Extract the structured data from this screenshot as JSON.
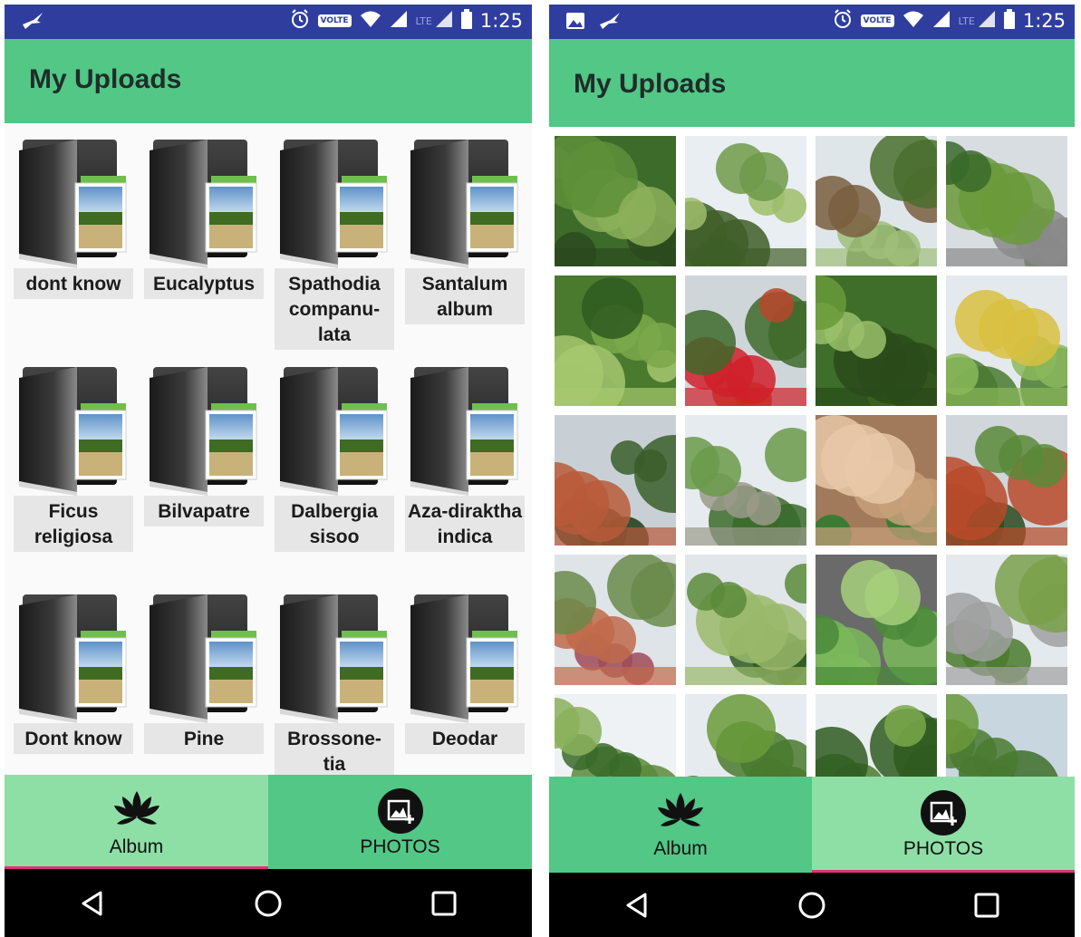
{
  "left": {
    "status_bar": {
      "time": "1:25",
      "volte": "VOLTE",
      "lte": "LTE"
    },
    "title": "My Uploads",
    "albums": [
      {
        "label": "dont know"
      },
      {
        "label": "Eucalyptus"
      },
      {
        "label": "Spathodia companu-lata"
      },
      {
        "label": "Santalum album"
      },
      {
        "label": "Ficus religiosa"
      },
      {
        "label": "Bilvapatre"
      },
      {
        "label": "Dalbergia sisoo"
      },
      {
        "label": "Aza-diraktha indica"
      },
      {
        "label": "Dont know"
      },
      {
        "label": "Pine"
      },
      {
        "label": "Brossone-tia"
      },
      {
        "label": "Deodar"
      }
    ],
    "tabs": {
      "album": "Album",
      "photos": "PHOTOS",
      "selected": "album"
    }
  },
  "right": {
    "status_bar": {
      "time": "1:25",
      "volte": "VOLTE",
      "lte": "LTE"
    },
    "title": "My Uploads",
    "photo_count_visible": 20,
    "tabs": {
      "album": "Album",
      "photos": "PHOTOS",
      "selected": "photos"
    }
  },
  "icons": {
    "status_left": [
      "bird-notification-icon"
    ],
    "status_left_right_phone": [
      "image-notification-icon",
      "bird-notification-icon"
    ],
    "status_right": [
      "alarm-icon",
      "volte-icon",
      "wifi-icon",
      "signal-icon",
      "battery-icon"
    ],
    "tab_album": "lotus-flower-icon",
    "tab_photos": "add-photo-icon",
    "system_nav": [
      "back-icon",
      "home-icon",
      "recents-icon"
    ]
  },
  "colors": {
    "status_bar": "#2f3e9e",
    "app_bar": "#52c786",
    "tab_selected": "#8ddfa6",
    "tab_indicator": "#e0307e",
    "label_bg": "#e6e6e6"
  }
}
